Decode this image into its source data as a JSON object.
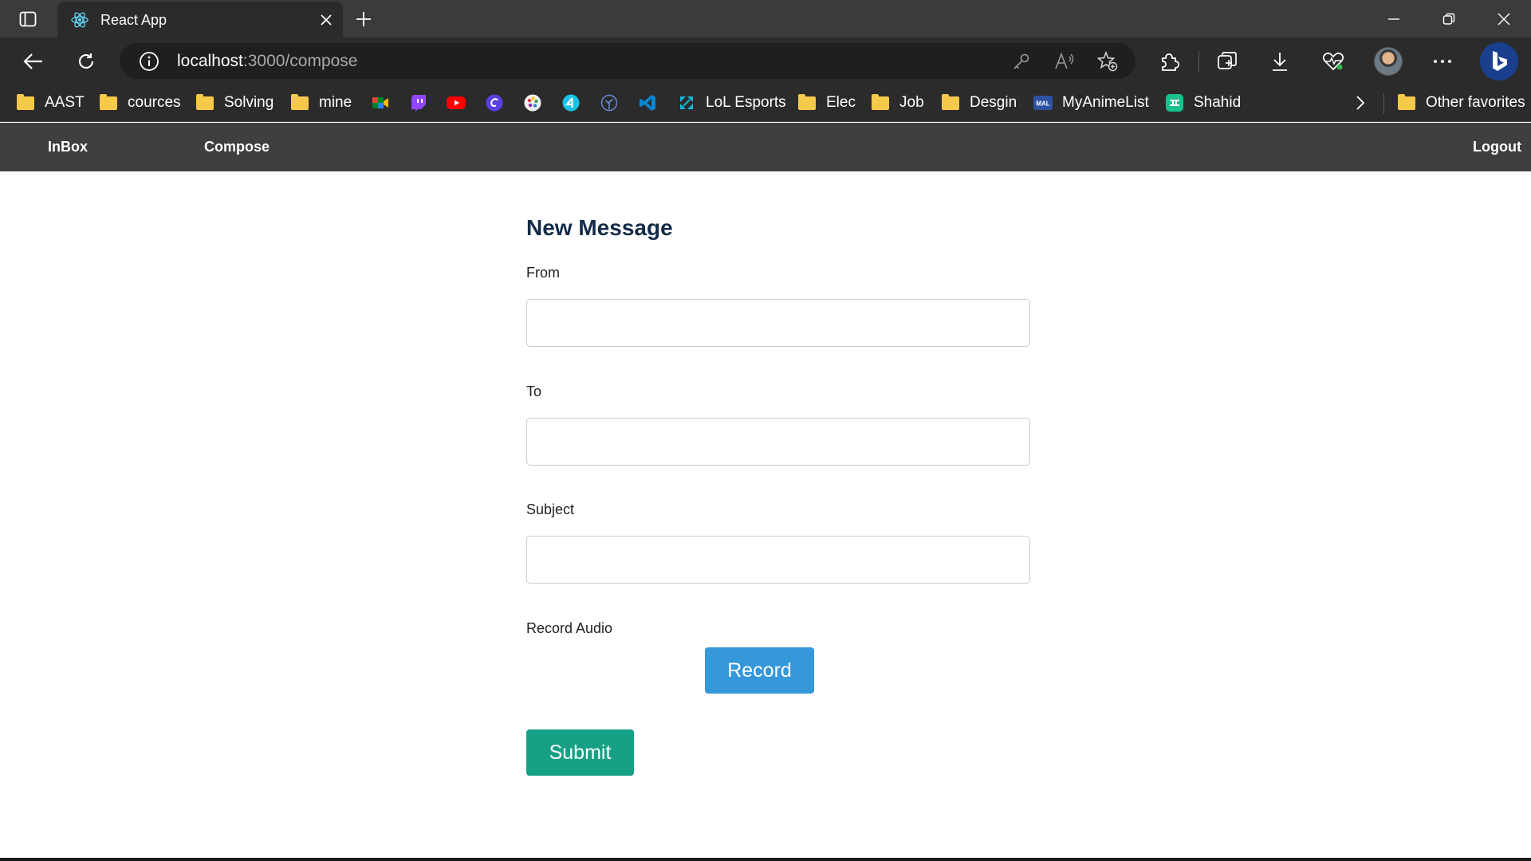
{
  "browser": {
    "tab_title": "React App",
    "url_host": "localhost",
    "url_path": ":3000/compose",
    "bookmarks": [
      {
        "label": "AAST",
        "icon": "folder-icon"
      },
      {
        "label": "cources",
        "icon": "folder-icon"
      },
      {
        "label": "Solving",
        "icon": "folder-icon"
      },
      {
        "label": "mine",
        "icon": "folder-icon"
      },
      {
        "label": "",
        "icon": "google-meet-icon"
      },
      {
        "label": "",
        "icon": "twitch-icon"
      },
      {
        "label": "",
        "icon": "youtube-icon"
      },
      {
        "label": "",
        "icon": "canva-icon"
      },
      {
        "label": "",
        "icon": "palette-icon"
      },
      {
        "label": "",
        "icon": "app-4-icon"
      },
      {
        "label": "",
        "icon": "tree-icon"
      },
      {
        "label": "",
        "icon": "vscode-icon"
      },
      {
        "label": "LoL Esports",
        "icon": "lol-esports-icon"
      },
      {
        "label": "Elec",
        "icon": "folder-icon"
      },
      {
        "label": "Job",
        "icon": "folder-icon"
      },
      {
        "label": "Desgin",
        "icon": "folder-icon"
      },
      {
        "label": "MyAnimeList",
        "icon": "myanimelist-icon"
      },
      {
        "label": "Shahid",
        "icon": "shahid-icon"
      }
    ],
    "other_favorites": "Other favorites"
  },
  "nav": {
    "inbox": "InBox",
    "compose": "Compose",
    "logout": "Logout"
  },
  "form": {
    "title": "New Message",
    "from_label": "From",
    "from_value": "",
    "to_label": "To",
    "to_value": "",
    "subject_label": "Subject",
    "subject_value": "",
    "record_label": "Record Audio",
    "record_button": "Record",
    "submit_button": "Submit"
  },
  "colors": {
    "heading": "#132b48",
    "record": "#3498db",
    "submit": "#16a085",
    "navbar": "#3f3f3f"
  }
}
